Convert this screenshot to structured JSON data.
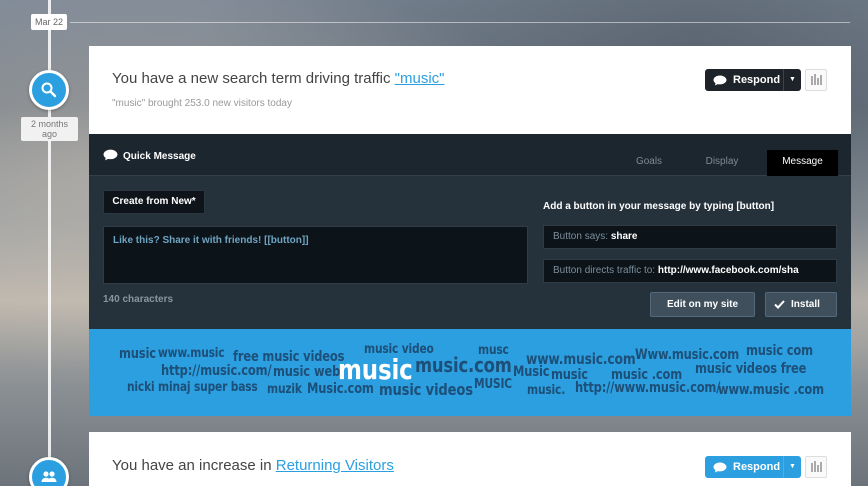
{
  "timeline": {
    "date": "Mar 22",
    "ago": [
      "2 months",
      "ago"
    ]
  },
  "card1": {
    "title_prefix": "You have a new search term driving traffic ",
    "title_link": "\"music\"",
    "subtitle": "\"music\" brought 253.0 new visitors today",
    "respond_label": "Respond"
  },
  "quick_message": {
    "title": "Quick Message",
    "tabs": [
      "Goals",
      "Display",
      "Message"
    ],
    "active_tab": "Message",
    "create_button": "Create from New*",
    "message_text": "Like this? Share it with friends! [[button]]",
    "char_count": "140 characters",
    "hint": "Add a button in your message by typing [button]",
    "button_says_label": "Button says: ",
    "button_says_value": "share",
    "button_directs_label": "Button directs traffic to: ",
    "button_directs_value": "http://www.facebook.com/sha",
    "edit_button": "Edit on my site",
    "install_button": "Install"
  },
  "word_cloud": [
    "music",
    "www.music",
    "free music videos",
    "music video",
    "musc",
    "www.music.com",
    "Www.music.com",
    "music com",
    "music.com",
    "http://music.com/",
    "music",
    "web",
    "music",
    "Music",
    "music",
    "music .com",
    "music videos free",
    "nicki minaj super bass",
    "muzik",
    "Music.com",
    "music videos",
    "MUSIC",
    "music.",
    "http://www.music.com/",
    "www.music .com"
  ],
  "card2": {
    "title_prefix": "You have an increase in ",
    "title_link": "Returning Visitors",
    "respond_label": "Respond"
  },
  "colors": {
    "accent": "#2b9fe0",
    "panel": "#25313b",
    "dark_button": "#1d2329"
  },
  "icons": [
    "search-icon",
    "visitors-icon",
    "speech-bubble-icon",
    "chevron-down-icon",
    "bar-chart-icon",
    "checkmark-icon"
  ]
}
